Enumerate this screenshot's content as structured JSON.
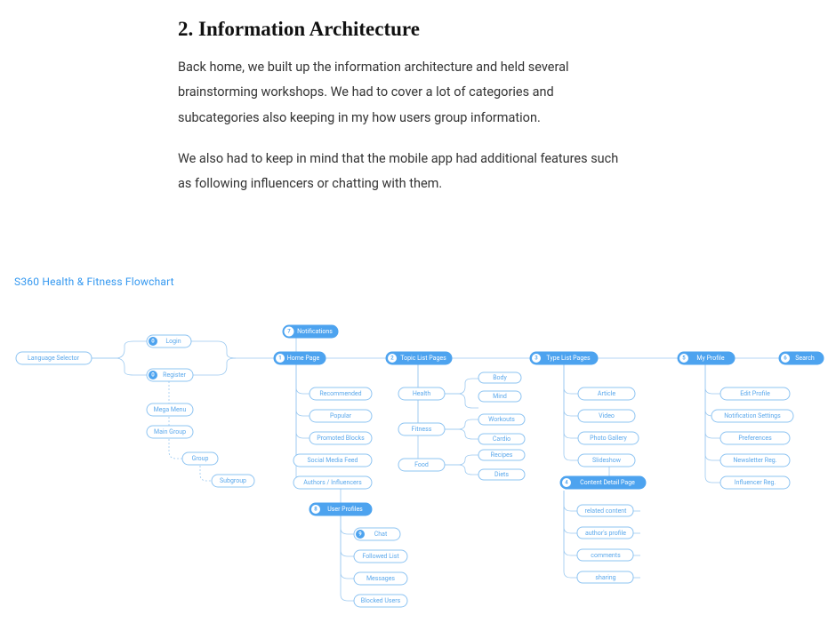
{
  "article": {
    "heading": "2. Information Architecture",
    "p1": "Back home, we built up the information architecture and held several brainstorming workshops. We had to cover a lot of categories and subcategories also keeping in my how users group information.",
    "p2": "We also had to keep in mind that the mobile app had additional features such as following influencers or chatting with them."
  },
  "flow": {
    "title": "S360 Health & Fitness Flowchart",
    "nodes": {
      "lang": "Language Selector",
      "login": "Login",
      "register": "Register",
      "mega": "Mega Menu",
      "maingroup": "Main Group",
      "group": "Group",
      "subgroup": "Subgroup",
      "home": "Home Page",
      "notif": "Notifications",
      "recommended": "Recommended",
      "popular": "Popular",
      "promoted": "Promoted Blocks",
      "social": "Social Media Feed",
      "authors": "Authors / Influencers",
      "userprofiles": "User Profiles",
      "chat": "Chat",
      "followed": "Followed List",
      "messages": "Messages",
      "blocked": "Blocked Users",
      "topiclist": "Topic List Pages",
      "health": "Health",
      "fitness": "Fitness",
      "food": "Food",
      "body": "Body",
      "mind": "Mind",
      "workouts": "Workouts",
      "cardio": "Cardio",
      "recipes": "Recipes",
      "diets": "Diets",
      "typelist": "Type List Pages",
      "article": "Article",
      "video": "Video",
      "gallery": "Photo Gallery",
      "slideshow": "Slideshow",
      "detail": "Content Detail Page",
      "related": "related content",
      "authprof": "author's profile",
      "comments": "comments",
      "sharing": "sharing",
      "myprofile": "My Profile",
      "editprof": "Edit Profile",
      "notifset": "Notification Settings",
      "pref": "Preferences",
      "newsreg": "Newsletter Reg.",
      "infreg": "Influencer Reg.",
      "search": "Search"
    },
    "badges": {
      "login": "0",
      "register": "0",
      "home": "1",
      "notif": "7",
      "topiclist": "2",
      "typelist": "3",
      "detail": "4",
      "myprofile": "5",
      "search": "6",
      "userprofiles": "8",
      "chat": "9"
    }
  }
}
